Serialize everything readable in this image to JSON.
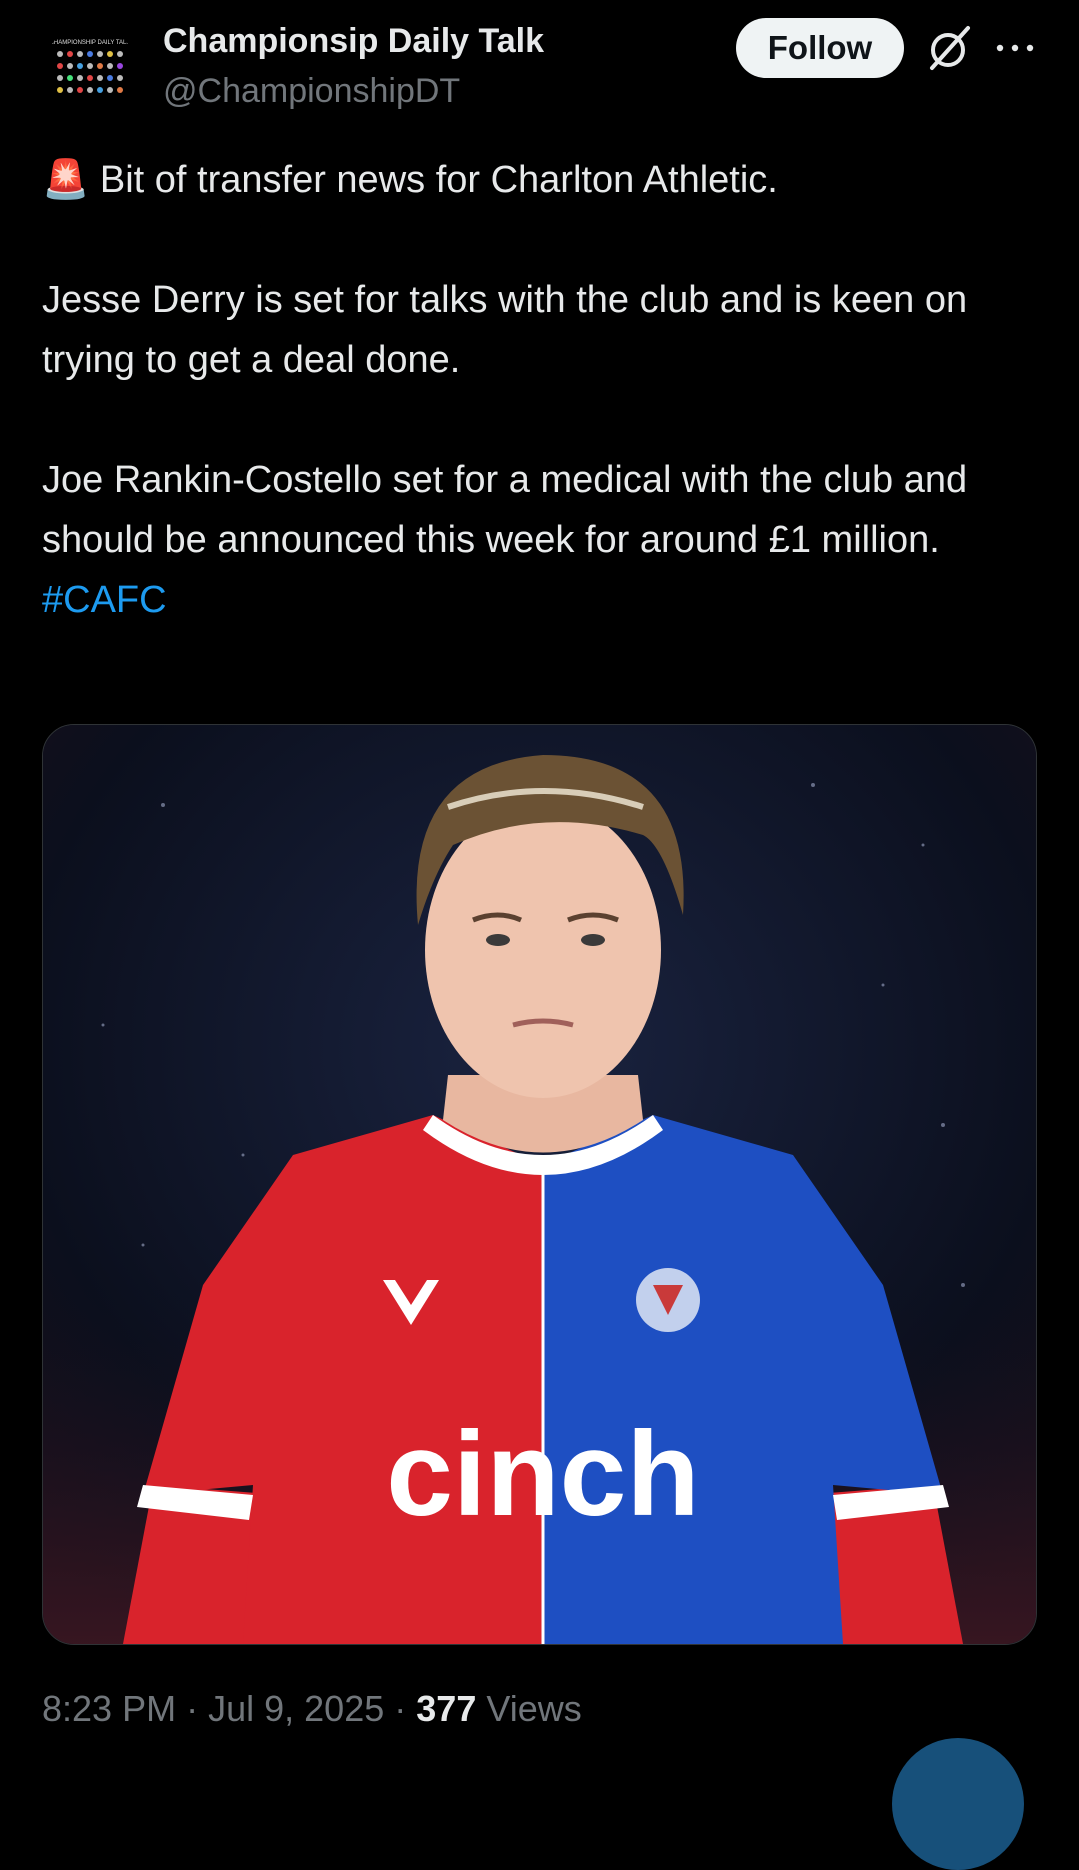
{
  "author": {
    "name": "Championsip Daily Talk",
    "handle": "@ChampionshipDT",
    "avatar_title": "CHAMPIONSHIP DAILY TALK"
  },
  "actions": {
    "follow_label": "Follow",
    "grok_icon": "grok-icon",
    "more_icon": "more-icon"
  },
  "tweet": {
    "emoji": "🚨",
    "line1": "Bit of transfer news for Charlton Athletic.",
    "para2": "Jesse Derry is set for talks with the club and is keen on trying to get a deal done.",
    "para3": "Joe Rankin-Costello set for a medical with the club and should be announced this week for around £1 million.",
    "hashtag": "#CAFC"
  },
  "media": {
    "shirt_sponsor": "cinch"
  },
  "meta": {
    "time": "8:23 PM",
    "separator": "·",
    "date": "Jul 9, 2025",
    "views_count": "377",
    "views_label": "Views"
  },
  "colors": {
    "background": "#000000",
    "link": "#1d9bf0",
    "secondary_text": "#71767b",
    "shirt_red": "#d9232c",
    "shirt_blue": "#1e4fc2"
  }
}
